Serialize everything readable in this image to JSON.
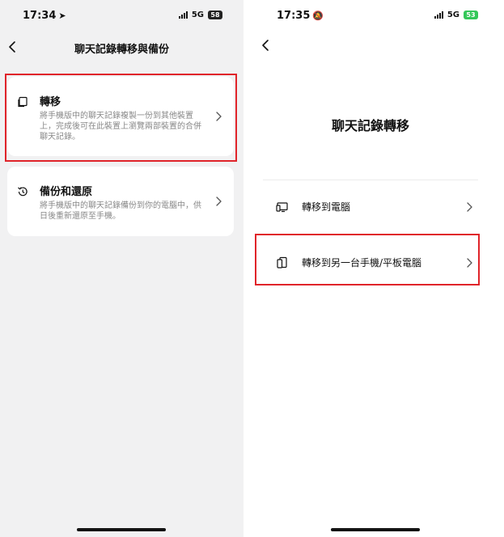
{
  "left_screen": {
    "status": {
      "time": "17:34",
      "network": "5G",
      "battery": "58"
    },
    "header": {
      "title": "聊天記錄轉移與備份"
    },
    "options": [
      {
        "title": "轉移",
        "description": "將手機版中的聊天記錄複製一份到其他裝置上，完成後可在此裝置上瀏覽兩部裝置的合併聊天記錄。"
      },
      {
        "title": "備份和還原",
        "description": "將手機版中的聊天記錄備份到你的電腦中，供日後重新還原至手機。"
      }
    ]
  },
  "right_screen": {
    "status": {
      "time": "17:35",
      "network": "5G",
      "battery": "53"
    },
    "title": "聊天記錄轉移",
    "options": [
      {
        "label": "轉移到電腦"
      },
      {
        "label": "轉移到另一台手機/平板電腦"
      }
    ]
  },
  "colors": {
    "highlight": "#e0242a",
    "battery_charging": "#34c759"
  }
}
